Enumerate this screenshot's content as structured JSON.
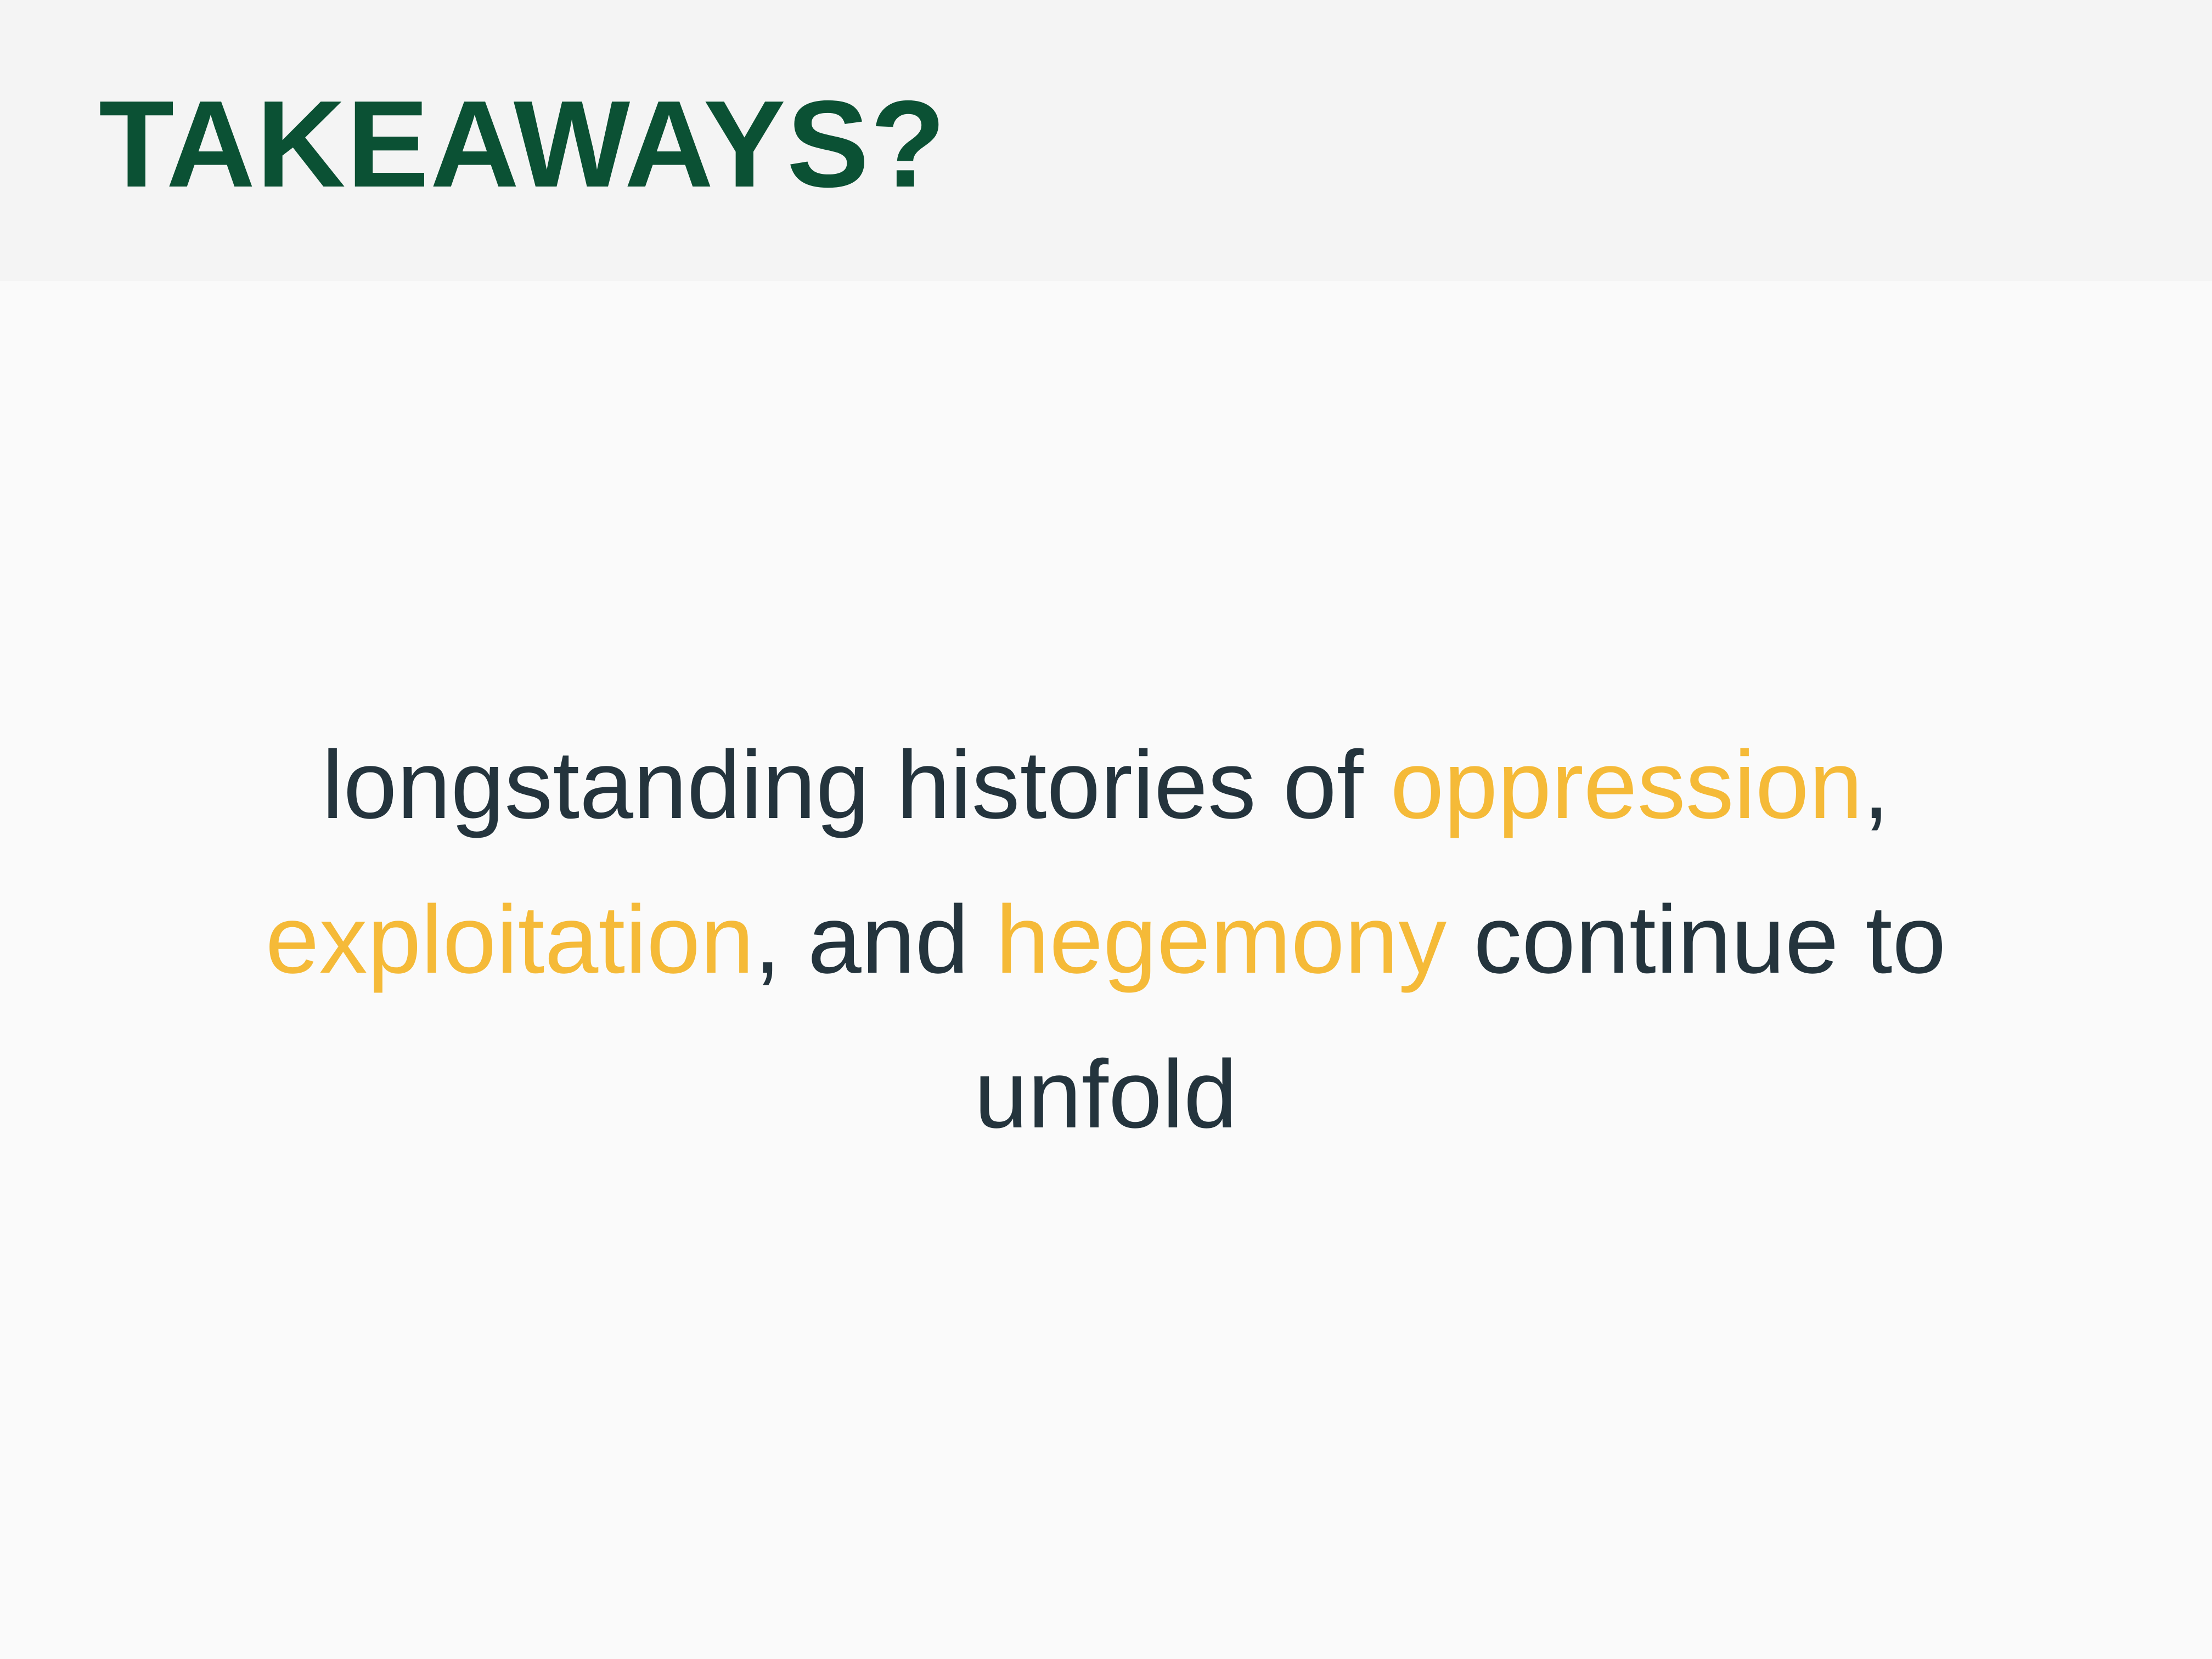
{
  "slide": {
    "title": "TAKEAWAYS?",
    "statement": {
      "segments": [
        {
          "text": "longstanding histories of ",
          "highlight": false
        },
        {
          "text": "oppression",
          "highlight": true
        },
        {
          "text": ", ",
          "highlight": false
        },
        {
          "text": "exploitation",
          "highlight": true
        },
        {
          "text": ", and ",
          "highlight": false
        },
        {
          "text": "hegemony",
          "highlight": true
        },
        {
          "text": " continue to unfold",
          "highlight": false
        }
      ]
    }
  },
  "colors": {
    "title": "#0b5134",
    "text": "#24343d",
    "highlight": "#f5ba38",
    "header_background": "#f4f4f4",
    "page_background": "#fafafa"
  }
}
